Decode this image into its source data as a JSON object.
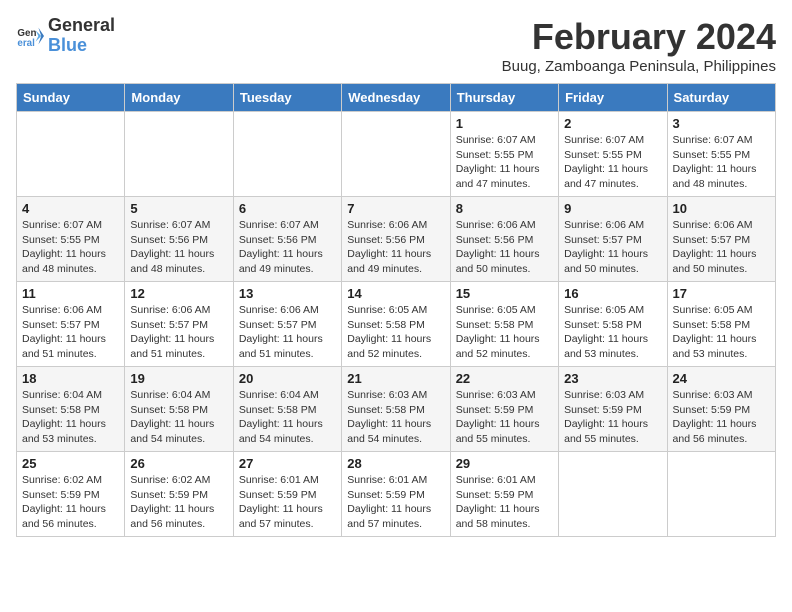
{
  "logo": {
    "line1": "General",
    "line2": "Blue"
  },
  "title": {
    "month_year": "February 2024",
    "location": "Buug, Zamboanga Peninsula, Philippines"
  },
  "weekdays": [
    "Sunday",
    "Monday",
    "Tuesday",
    "Wednesday",
    "Thursday",
    "Friday",
    "Saturday"
  ],
  "weeks": [
    [
      {
        "day": "",
        "sunrise": "",
        "sunset": "",
        "daylight": ""
      },
      {
        "day": "",
        "sunrise": "",
        "sunset": "",
        "daylight": ""
      },
      {
        "day": "",
        "sunrise": "",
        "sunset": "",
        "daylight": ""
      },
      {
        "day": "",
        "sunrise": "",
        "sunset": "",
        "daylight": ""
      },
      {
        "day": "1",
        "sunrise": "Sunrise: 6:07 AM",
        "sunset": "Sunset: 5:55 PM",
        "daylight": "Daylight: 11 hours and 47 minutes."
      },
      {
        "day": "2",
        "sunrise": "Sunrise: 6:07 AM",
        "sunset": "Sunset: 5:55 PM",
        "daylight": "Daylight: 11 hours and 47 minutes."
      },
      {
        "day": "3",
        "sunrise": "Sunrise: 6:07 AM",
        "sunset": "Sunset: 5:55 PM",
        "daylight": "Daylight: 11 hours and 48 minutes."
      }
    ],
    [
      {
        "day": "4",
        "sunrise": "Sunrise: 6:07 AM",
        "sunset": "Sunset: 5:55 PM",
        "daylight": "Daylight: 11 hours and 48 minutes."
      },
      {
        "day": "5",
        "sunrise": "Sunrise: 6:07 AM",
        "sunset": "Sunset: 5:56 PM",
        "daylight": "Daylight: 11 hours and 48 minutes."
      },
      {
        "day": "6",
        "sunrise": "Sunrise: 6:07 AM",
        "sunset": "Sunset: 5:56 PM",
        "daylight": "Daylight: 11 hours and 49 minutes."
      },
      {
        "day": "7",
        "sunrise": "Sunrise: 6:06 AM",
        "sunset": "Sunset: 5:56 PM",
        "daylight": "Daylight: 11 hours and 49 minutes."
      },
      {
        "day": "8",
        "sunrise": "Sunrise: 6:06 AM",
        "sunset": "Sunset: 5:56 PM",
        "daylight": "Daylight: 11 hours and 50 minutes."
      },
      {
        "day": "9",
        "sunrise": "Sunrise: 6:06 AM",
        "sunset": "Sunset: 5:57 PM",
        "daylight": "Daylight: 11 hours and 50 minutes."
      },
      {
        "day": "10",
        "sunrise": "Sunrise: 6:06 AM",
        "sunset": "Sunset: 5:57 PM",
        "daylight": "Daylight: 11 hours and 50 minutes."
      }
    ],
    [
      {
        "day": "11",
        "sunrise": "Sunrise: 6:06 AM",
        "sunset": "Sunset: 5:57 PM",
        "daylight": "Daylight: 11 hours and 51 minutes."
      },
      {
        "day": "12",
        "sunrise": "Sunrise: 6:06 AM",
        "sunset": "Sunset: 5:57 PM",
        "daylight": "Daylight: 11 hours and 51 minutes."
      },
      {
        "day": "13",
        "sunrise": "Sunrise: 6:06 AM",
        "sunset": "Sunset: 5:57 PM",
        "daylight": "Daylight: 11 hours and 51 minutes."
      },
      {
        "day": "14",
        "sunrise": "Sunrise: 6:05 AM",
        "sunset": "Sunset: 5:58 PM",
        "daylight": "Daylight: 11 hours and 52 minutes."
      },
      {
        "day": "15",
        "sunrise": "Sunrise: 6:05 AM",
        "sunset": "Sunset: 5:58 PM",
        "daylight": "Daylight: 11 hours and 52 minutes."
      },
      {
        "day": "16",
        "sunrise": "Sunrise: 6:05 AM",
        "sunset": "Sunset: 5:58 PM",
        "daylight": "Daylight: 11 hours and 53 minutes."
      },
      {
        "day": "17",
        "sunrise": "Sunrise: 6:05 AM",
        "sunset": "Sunset: 5:58 PM",
        "daylight": "Daylight: 11 hours and 53 minutes."
      }
    ],
    [
      {
        "day": "18",
        "sunrise": "Sunrise: 6:04 AM",
        "sunset": "Sunset: 5:58 PM",
        "daylight": "Daylight: 11 hours and 53 minutes."
      },
      {
        "day": "19",
        "sunrise": "Sunrise: 6:04 AM",
        "sunset": "Sunset: 5:58 PM",
        "daylight": "Daylight: 11 hours and 54 minutes."
      },
      {
        "day": "20",
        "sunrise": "Sunrise: 6:04 AM",
        "sunset": "Sunset: 5:58 PM",
        "daylight": "Daylight: 11 hours and 54 minutes."
      },
      {
        "day": "21",
        "sunrise": "Sunrise: 6:03 AM",
        "sunset": "Sunset: 5:58 PM",
        "daylight": "Daylight: 11 hours and 54 minutes."
      },
      {
        "day": "22",
        "sunrise": "Sunrise: 6:03 AM",
        "sunset": "Sunset: 5:59 PM",
        "daylight": "Daylight: 11 hours and 55 minutes."
      },
      {
        "day": "23",
        "sunrise": "Sunrise: 6:03 AM",
        "sunset": "Sunset: 5:59 PM",
        "daylight": "Daylight: 11 hours and 55 minutes."
      },
      {
        "day": "24",
        "sunrise": "Sunrise: 6:03 AM",
        "sunset": "Sunset: 5:59 PM",
        "daylight": "Daylight: 11 hours and 56 minutes."
      }
    ],
    [
      {
        "day": "25",
        "sunrise": "Sunrise: 6:02 AM",
        "sunset": "Sunset: 5:59 PM",
        "daylight": "Daylight: 11 hours and 56 minutes."
      },
      {
        "day": "26",
        "sunrise": "Sunrise: 6:02 AM",
        "sunset": "Sunset: 5:59 PM",
        "daylight": "Daylight: 11 hours and 56 minutes."
      },
      {
        "day": "27",
        "sunrise": "Sunrise: 6:01 AM",
        "sunset": "Sunset: 5:59 PM",
        "daylight": "Daylight: 11 hours and 57 minutes."
      },
      {
        "day": "28",
        "sunrise": "Sunrise: 6:01 AM",
        "sunset": "Sunset: 5:59 PM",
        "daylight": "Daylight: 11 hours and 57 minutes."
      },
      {
        "day": "29",
        "sunrise": "Sunrise: 6:01 AM",
        "sunset": "Sunset: 5:59 PM",
        "daylight": "Daylight: 11 hours and 58 minutes."
      },
      {
        "day": "",
        "sunrise": "",
        "sunset": "",
        "daylight": ""
      },
      {
        "day": "",
        "sunrise": "",
        "sunset": "",
        "daylight": ""
      }
    ]
  ]
}
